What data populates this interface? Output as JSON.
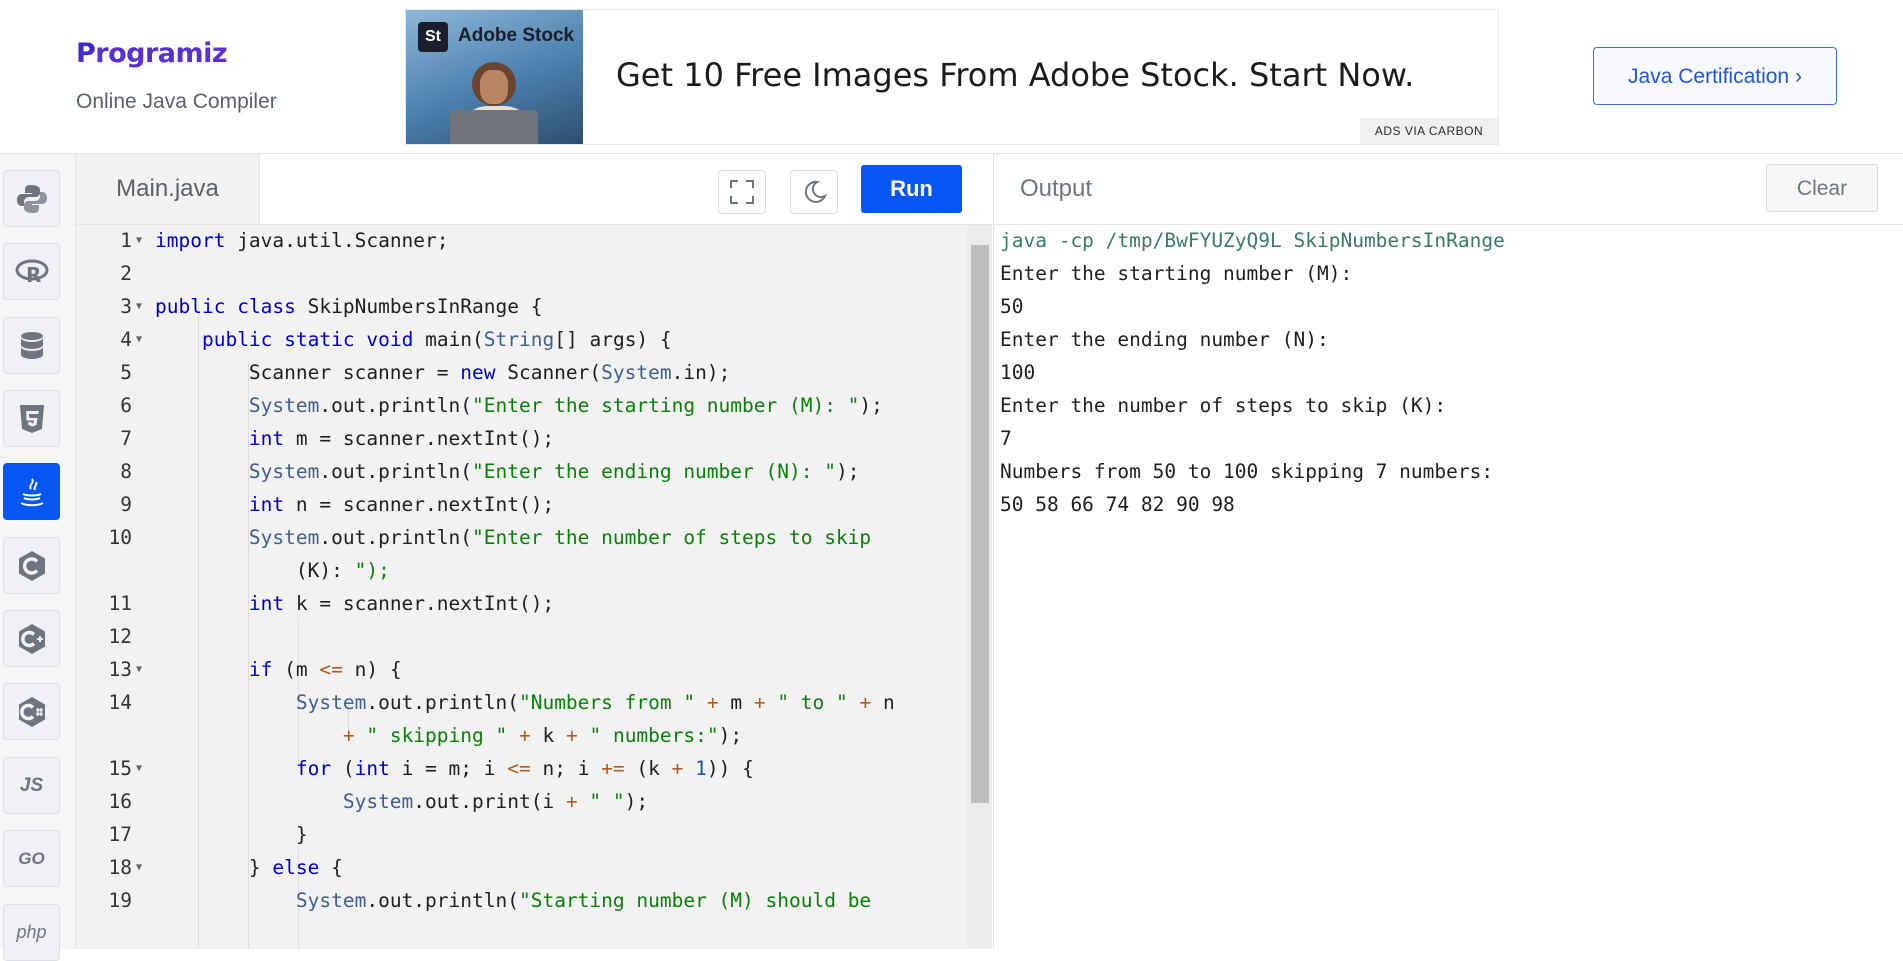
{
  "header": {
    "logo_brand": "Programiz",
    "logo_subtitle": "Online Java Compiler",
    "ad": {
      "image_badge": "St",
      "image_label": "Adobe Stock",
      "text": "Get 10 Free Images From Adobe Stock. Start Now.",
      "via": "ADS VIA CARBON"
    },
    "cta_label": "Java Certification ›"
  },
  "sidebar": {
    "items": [
      {
        "name": "python-icon"
      },
      {
        "name": "r-icon"
      },
      {
        "name": "sql-icon"
      },
      {
        "name": "html5-icon"
      },
      {
        "name": "java-icon",
        "active": true
      },
      {
        "name": "c-icon"
      },
      {
        "name": "cpp-icon"
      },
      {
        "name": "csharp-icon"
      },
      {
        "name": "js-icon",
        "label": "JS"
      },
      {
        "name": "go-icon",
        "label": "GO"
      },
      {
        "name": "php-icon",
        "label": "php"
      }
    ]
  },
  "editor": {
    "file_name": "Main.java",
    "run_label": "Run",
    "line_numbers": [
      "1",
      "2",
      "3",
      "4",
      "5",
      "6",
      "7",
      "8",
      "9",
      "10",
      "11",
      "12",
      "13",
      "14",
      "15",
      "16",
      "17",
      "18",
      "19"
    ],
    "code_lines": [
      "import java.util.Scanner;",
      "",
      "public class SkipNumbersInRange {",
      "    public static void main(String[] args) {",
      "        Scanner scanner = new Scanner(System.in);",
      "        System.out.println(\"Enter the starting number (M): \");",
      "        int m = scanner.nextInt();",
      "        System.out.println(\"Enter the ending number (N): \");",
      "        int n = scanner.nextInt();",
      "        System.out.println(\"Enter the number of steps to skip",
      "            (K): \");",
      "        int k = scanner.nextInt();",
      "",
      "        if (m <= n) {",
      "            System.out.println(\"Numbers from \" + m + \" to \" + n",
      "                + \" skipping \" + k + \" numbers:\");",
      "            for (int i = m; i <= n; i += (k + 1)) {",
      "                System.out.print(i + \" \");",
      "            }",
      "        } else {",
      "            System.out.println(\"Starting number (M) should be"
    ]
  },
  "output": {
    "title": "Output",
    "clear_label": "Clear",
    "lines": [
      "java -cp /tmp/BwFYUZyQ9L SkipNumbersInRange",
      "Enter the starting number (M):",
      "50",
      "Enter the ending number (N):",
      "100",
      "Enter the number of steps to skip (K):",
      "7",
      "Numbers from 50 to 100 skipping 7 numbers:",
      "50 58 66 74 82 90 98"
    ]
  }
}
